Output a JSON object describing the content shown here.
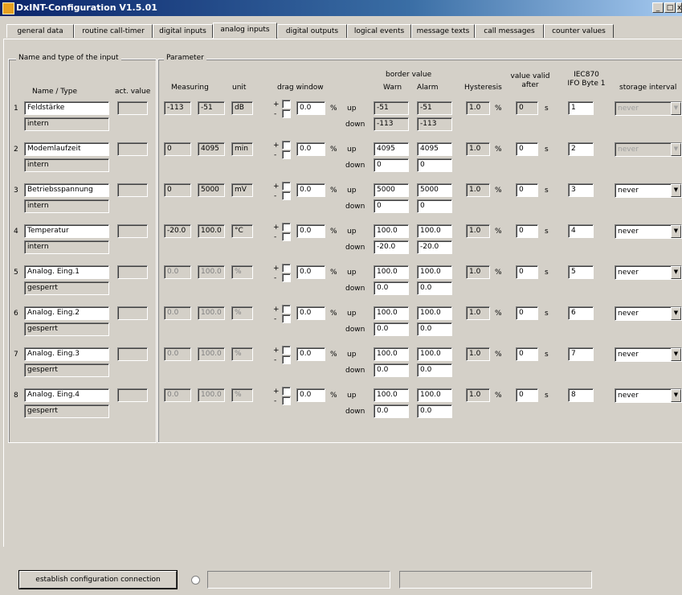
{
  "window": {
    "title": "DxINT-Configuration V1.5.01",
    "minimize": "_",
    "restore": "□",
    "close": "x"
  },
  "tabs": [
    {
      "label": "general data"
    },
    {
      "label": "routine call-timer"
    },
    {
      "label": "digital inputs"
    },
    {
      "label": "analog inputs",
      "active": true
    },
    {
      "label": "digital outputs"
    },
    {
      "label": "logical events"
    },
    {
      "label": "message texts"
    },
    {
      "label": "call messages"
    },
    {
      "label": "counter values"
    }
  ],
  "groups": {
    "input_title": "Name and type of the input",
    "parameter_title": "Parameter"
  },
  "headers": {
    "name_type": "Name / Type",
    "act_value": "act. value",
    "measuring": "Measuring",
    "unit": "unit",
    "drag_window": "drag window",
    "border_value": "border value",
    "warn": "Warn",
    "alarm": "Alarm",
    "hysteresis": "Hysteresis",
    "valid_1": "value valid",
    "valid_2": "after",
    "iec_1": "IEC870",
    "iec_2": "IFO Byte 1",
    "storage": "storage interval"
  },
  "row_labels": {
    "up": "up",
    "down": "down",
    "plus": "+",
    "minus": "-",
    "percent": "%",
    "seconds": "s"
  },
  "rows": [
    {
      "num": "1",
      "name": "Feldstärke",
      "type": "intern",
      "act": "",
      "min": "-113",
      "max": "-51",
      "unit": "dB",
      "drag": "0.0",
      "warn_up": "-51",
      "alarm_up": "-51",
      "warn_down": "-113",
      "alarm_down": "-113",
      "hyst": "1.0",
      "valid": "0",
      "iec": "1",
      "storage": "never",
      "enabled": true,
      "border_ro": true,
      "storage_dis": true,
      "valid_ro": true
    },
    {
      "num": "2",
      "name": "Modemlaufzeit",
      "type": "intern",
      "act": "",
      "min": "0",
      "max": "4095",
      "unit": "min",
      "drag": "0.0",
      "warn_up": "4095",
      "alarm_up": "4095",
      "warn_down": "0",
      "alarm_down": "0",
      "hyst": "1.0",
      "valid": "0",
      "iec": "2",
      "storage": "never",
      "enabled": true,
      "border_ro": false,
      "storage_dis": true,
      "valid_ro": false
    },
    {
      "num": "3",
      "name": "Betriebsspannung",
      "type": "intern",
      "act": "",
      "min": "0",
      "max": "5000",
      "unit": "mV",
      "drag": "0.0",
      "warn_up": "5000",
      "alarm_up": "5000",
      "warn_down": "0",
      "alarm_down": "0",
      "hyst": "1.0",
      "valid": "0",
      "iec": "3",
      "storage": "never",
      "enabled": true,
      "border_ro": false,
      "storage_dis": false,
      "valid_ro": false
    },
    {
      "num": "4",
      "name": "Temperatur",
      "type": "intern",
      "act": "",
      "min": "-20.0",
      "max": "100.0",
      "unit": "°C",
      "drag": "0.0",
      "warn_up": "100.0",
      "alarm_up": "100.0",
      "warn_down": "-20.0",
      "alarm_down": "-20.0",
      "hyst": "1.0",
      "valid": "0",
      "iec": "4",
      "storage": "never",
      "enabled": true,
      "border_ro": false,
      "storage_dis": false,
      "valid_ro": false
    },
    {
      "num": "5",
      "name": "Analog. Eing.1",
      "type": "gesperrt",
      "act": "",
      "min": "0.0",
      "max": "100.0",
      "unit": "%",
      "drag": "0.0",
      "warn_up": "100.0",
      "alarm_up": "100.0",
      "warn_down": "0.0",
      "alarm_down": "0.0",
      "hyst": "1.0",
      "valid": "0",
      "iec": "5",
      "storage": "never",
      "enabled": false,
      "border_ro": false,
      "storage_dis": false,
      "valid_ro": false
    },
    {
      "num": "6",
      "name": "Analog. Eing.2",
      "type": "gesperrt",
      "act": "",
      "min": "0.0",
      "max": "100.0",
      "unit": "%",
      "drag": "0.0",
      "warn_up": "100.0",
      "alarm_up": "100.0",
      "warn_down": "0.0",
      "alarm_down": "0.0",
      "hyst": "1.0",
      "valid": "0",
      "iec": "6",
      "storage": "never",
      "enabled": false,
      "border_ro": false,
      "storage_dis": false,
      "valid_ro": false
    },
    {
      "num": "7",
      "name": "Analog. Eing.3",
      "type": "gesperrt",
      "act": "",
      "min": "0.0",
      "max": "100.0",
      "unit": "%",
      "drag": "0.0",
      "warn_up": "100.0",
      "alarm_up": "100.0",
      "warn_down": "0.0",
      "alarm_down": "0.0",
      "hyst": "1.0",
      "valid": "0",
      "iec": "7",
      "storage": "never",
      "enabled": false,
      "border_ro": false,
      "storage_dis": false,
      "valid_ro": false
    },
    {
      "num": "8",
      "name": "Analog. Eing.4",
      "type": "gesperrt",
      "act": "",
      "min": "0.0",
      "max": "100.0",
      "unit": "%",
      "drag": "0.0",
      "warn_up": "100.0",
      "alarm_up": "100.0",
      "warn_down": "0.0",
      "alarm_down": "0.0",
      "hyst": "1.0",
      "valid": "0",
      "iec": "8",
      "storage": "never",
      "enabled": false,
      "border_ro": false,
      "storage_dis": false,
      "valid_ro": false
    }
  ],
  "bottom": {
    "connect_label": "establish configuration connection",
    "status_1": "",
    "status_2": ""
  }
}
